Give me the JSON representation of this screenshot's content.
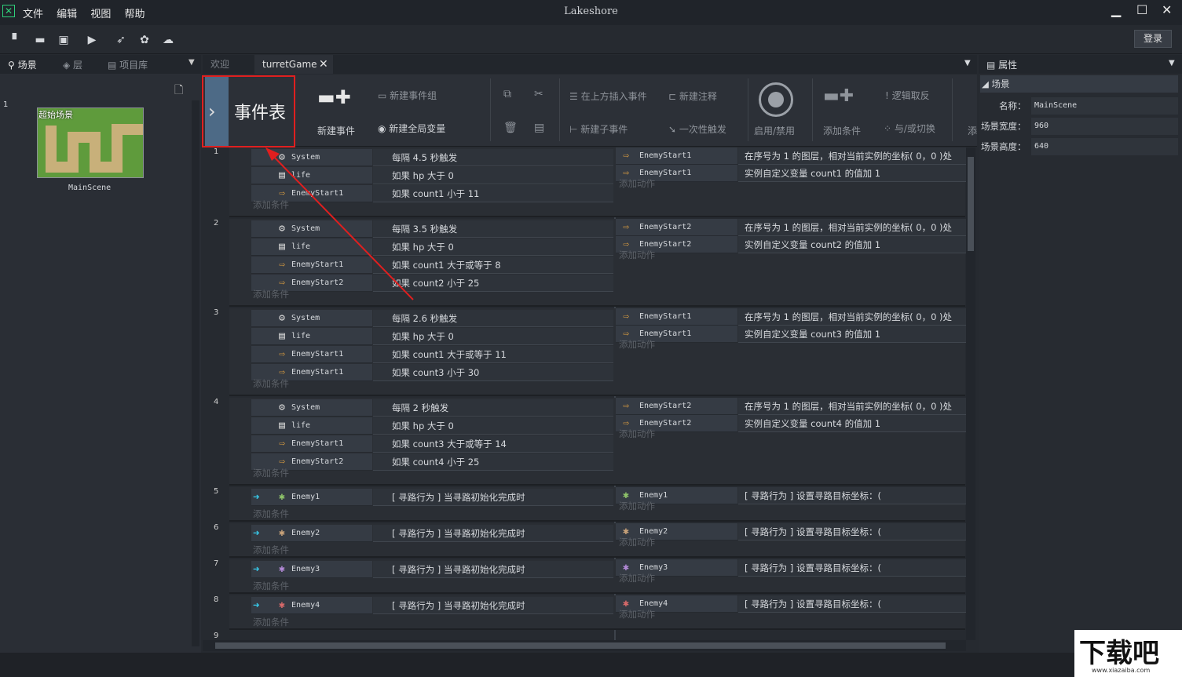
{
  "app": {
    "title": "Lakeshore",
    "login": "登录",
    "logo": "✕"
  },
  "menu": [
    "文件",
    "编辑",
    "视图",
    "帮助"
  ],
  "window_controls": {
    "minimize": "▁",
    "maximize": "☐",
    "close": "✕"
  },
  "left_tabs": [
    "场景",
    "层",
    "项目库"
  ],
  "scene": {
    "index": "1",
    "thumb_label": "超始场景",
    "name": "MainScene"
  },
  "center_tabs": [
    "欢迎",
    "turretGame"
  ],
  "ribbon": {
    "title": "事件表",
    "new_event": "新建事件",
    "new_group": "新建事件组",
    "new_global": "新建全局变量",
    "insert_above": "在上方插入事件",
    "new_sub": "新建子事件",
    "new_comment": "新建注释",
    "once": "一次性触发",
    "toggle": "启用/禁用",
    "add_cond": "添加条件",
    "invert": "逻辑取反",
    "and_or": "与/或切换",
    "more": "添"
  },
  "events": [
    {
      "num": "1",
      "rows": [
        {
          "obj": "System",
          "cond": "每隔 4.5 秒触发"
        },
        {
          "obj": "life",
          "cond": "如果 hp 大于 0"
        },
        {
          "obj": "EnemyStart1",
          "cond": "如果 count1 小于 11"
        }
      ],
      "actions": [
        {
          "obj": "EnemyStart1",
          "act": "在序号为 1 的图层，相对当前实例的坐标( 0，0 )处"
        },
        {
          "obj": "EnemyStart1",
          "act": "实例自定义变量 count1 的值加 1"
        }
      ]
    },
    {
      "num": "2",
      "rows": [
        {
          "obj": "System",
          "cond": "每隔 3.5 秒触发"
        },
        {
          "obj": "life",
          "cond": "如果 hp 大于 0"
        },
        {
          "obj": "EnemyStart1",
          "cond": "如果 count1 大于或等于 8"
        },
        {
          "obj": "EnemyStart2",
          "cond": "如果 count2 小于 25"
        }
      ],
      "actions": [
        {
          "obj": "EnemyStart2",
          "act": "在序号为 1 的图层，相对当前实例的坐标( 0，0 )处"
        },
        {
          "obj": "EnemyStart2",
          "act": "实例自定义变量 count2 的值加 1"
        }
      ]
    },
    {
      "num": "3",
      "rows": [
        {
          "obj": "System",
          "cond": "每隔 2.6 秒触发"
        },
        {
          "obj": "life",
          "cond": "如果 hp 大于 0"
        },
        {
          "obj": "EnemyStart1",
          "cond": "如果 count1 大于或等于 11"
        },
        {
          "obj": "EnemyStart1",
          "cond": "如果 count3 小于 30"
        }
      ],
      "actions": [
        {
          "obj": "EnemyStart1",
          "act": "在序号为 1 的图层，相对当前实例的坐标( 0，0 )处"
        },
        {
          "obj": "EnemyStart1",
          "act": "实例自定义变量 count3 的值加 1"
        }
      ]
    },
    {
      "num": "4",
      "rows": [
        {
          "obj": "System",
          "cond": "每隔 2 秒触发"
        },
        {
          "obj": "life",
          "cond": "如果 hp 大于 0"
        },
        {
          "obj": "EnemyStart1",
          "cond": "如果 count3 大于或等于 14"
        },
        {
          "obj": "EnemyStart2",
          "cond": "如果 count4 小于 25"
        }
      ],
      "actions": [
        {
          "obj": "EnemyStart2",
          "act": "在序号为 1 的图层，相对当前实例的坐标( 0，0 )处"
        },
        {
          "obj": "EnemyStart2",
          "act": "实例自定义变量 count4 的值加 1"
        }
      ]
    },
    {
      "num": "5",
      "rows": [
        {
          "obj": "Enemy1",
          "cond": "[ 寻路行为 ] 当寻路初始化完成时"
        }
      ],
      "actions": [
        {
          "obj": "Enemy1",
          "act": "[ 寻路行为 ] 设置寻路目标坐标：("
        }
      ]
    },
    {
      "num": "6",
      "rows": [
        {
          "obj": "Enemy2",
          "cond": "[ 寻路行为 ] 当寻路初始化完成时"
        }
      ],
      "actions": [
        {
          "obj": "Enemy2",
          "act": "[ 寻路行为 ] 设置寻路目标坐标：("
        }
      ]
    },
    {
      "num": "7",
      "rows": [
        {
          "obj": "Enemy3",
          "cond": "[ 寻路行为 ] 当寻路初始化完成时"
        }
      ],
      "actions": [
        {
          "obj": "Enemy3",
          "act": "[ 寻路行为 ] 设置寻路目标坐标：("
        }
      ]
    },
    {
      "num": "8",
      "rows": [
        {
          "obj": "Enemy4",
          "cond": "[ 寻路行为 ] 当寻路初始化完成时"
        }
      ],
      "actions": [
        {
          "obj": "Enemy4",
          "act": "[ 寻路行为 ] 设置寻路目标坐标：("
        }
      ]
    }
  ],
  "add_condition": "添加条件",
  "add_action": "添加动作",
  "next_event_num": "9",
  "properties": {
    "tab": "属性",
    "section": "场景",
    "fields": [
      {
        "label": "名称：",
        "value": "MainScene"
      },
      {
        "label": "场景宽度：",
        "value": "960"
      },
      {
        "label": "场景高度：",
        "value": "640"
      }
    ]
  },
  "watermark": {
    "text": "下载吧",
    "url": "www.xiazaiba.com"
  }
}
